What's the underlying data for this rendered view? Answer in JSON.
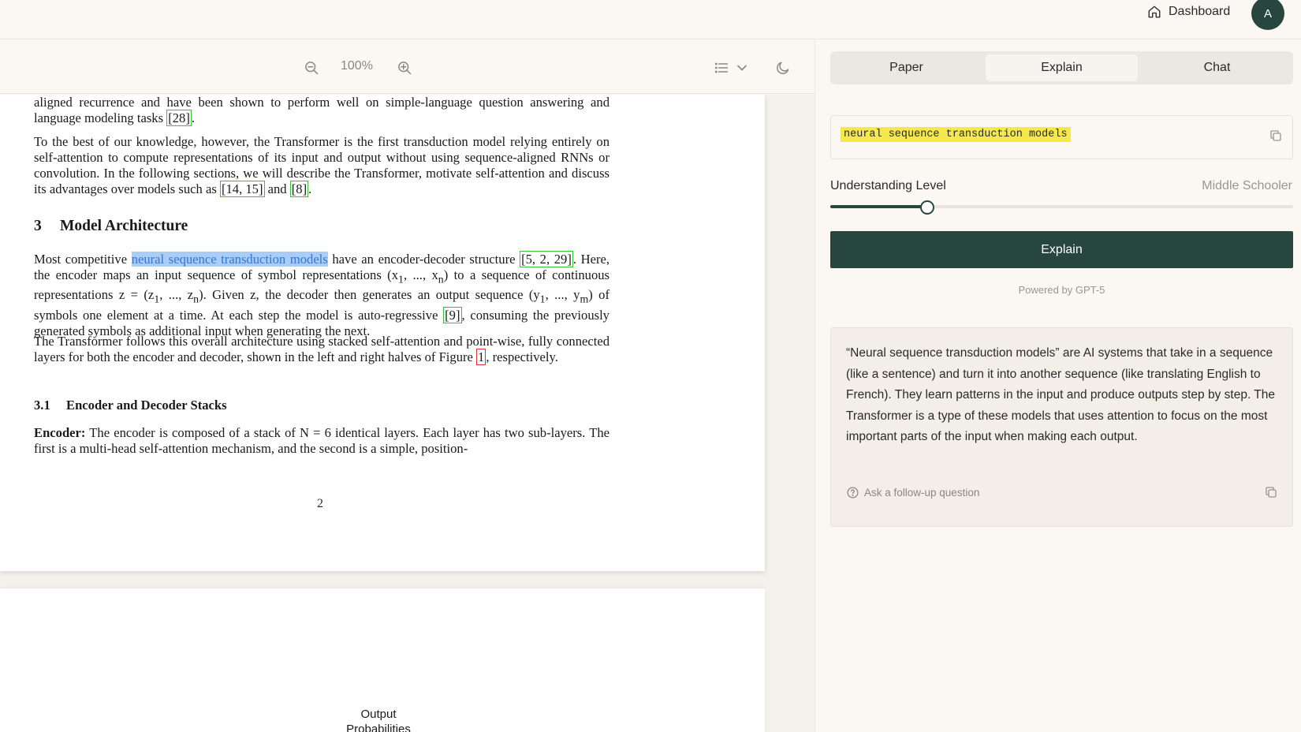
{
  "header": {
    "dashboard_label": "Dashboard",
    "avatar_initial": "A"
  },
  "toolbar": {
    "zoom_level": "100%"
  },
  "document": {
    "para_top": [
      "aligned recurrence and have been shown to perform well on simple-language question answering and language modeling tasks ",
      "[28]",
      "."
    ],
    "para_transformer": [
      "To the best of our knowledge, however, the Transformer is the first transduction model relying entirely on self-attention to compute representations of its input and output without using sequence-aligned RNNs or convolution. In the following sections, we will describe the Transformer, motivate self-attention and discuss its advantages over models such as ",
      "[14, 15]",
      " and ",
      "[8]",
      "."
    ],
    "section3_number": "3",
    "section3_title": "Model Architecture",
    "para_arch": [
      "Most competitive ",
      "neural sequence transduction models",
      " have an encoder-decoder structure ",
      "[5, 2, 29]",
      ". Here, the encoder maps an input sequence of symbol representations (x",
      "1",
      ", ..., x",
      "n",
      ") to a sequence of continuous representations z = (z",
      "1",
      ", ..., z",
      "n",
      "). Given z, the decoder then generates an output sequence (y",
      "1",
      ", ..., y",
      "m",
      ") of symbols one element at a time. At each step the model is auto-regressive ",
      "[9]",
      ", consuming the previously generated symbols as additional input when generating the next."
    ],
    "para_follows": [
      "The Transformer follows this overall architecture using stacked self-attention and point-wise, fully connected layers for both the encoder and decoder, shown in the left and right halves of Figure ",
      "1",
      ", respectively."
    ],
    "section31_number": "3.1",
    "section31_title": "Encoder and Decoder Stacks",
    "para_encoder": [
      "Encoder:",
      "  The encoder is composed of a stack of N = 6 identical layers. Each layer has two sub-layers. The first is a multi-head self-attention mechanism, and the second is a simple, position-"
    ],
    "page_number": "2",
    "figure_label": "Output Probabilities"
  },
  "panel": {
    "tabs": [
      "Paper",
      "Explain",
      "Chat"
    ],
    "active_tab": "Explain",
    "selected_text": "neural sequence transduction models",
    "understanding_label": "Understanding Level",
    "understanding_value": "Middle Schooler",
    "slider_fraction": 0.21,
    "explain_button": "Explain",
    "powered_by": "Powered by GPT-5",
    "answer": "“Neural sequence transduction models” are AI systems that take in a sequence (like a sentence) and turn it into another sequence (like translating English to French). They learn patterns in the input and produce outputs step by step. The Transformer is a type of these models that uses attention to focus on the most important parts of the input when making each output.",
    "followup_label": "Ask a follow-up question"
  },
  "colors": {
    "accent": "#26463e",
    "highlight_selection": "#a9cdf7",
    "highlight_code": "#f4e84a",
    "citation_border": "#38c238",
    "figure_ref_border": "#e23030"
  },
  "icons": [
    "home-icon",
    "zoom-out-icon",
    "zoom-in-icon",
    "list-icon",
    "chevron-down-icon",
    "moon-icon",
    "copy-icon",
    "help-circle-icon"
  ]
}
